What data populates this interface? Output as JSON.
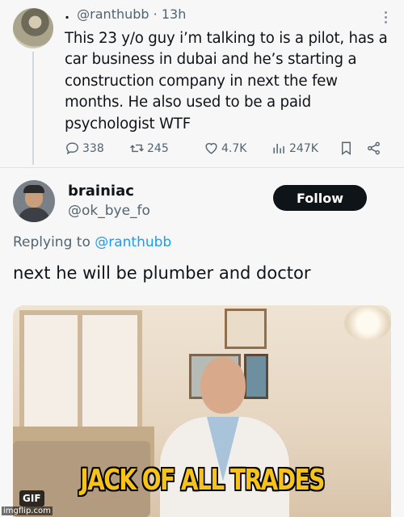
{
  "tweet": {
    "author_name": ".",
    "handle": "@ranthubb",
    "time": "13h",
    "text_lines": [
      "This 23 y/o guy i’m talking to is a pilot, has a",
      "car business in dubai and he’s starting a",
      "construction company in next the few",
      "months. He also used to be a paid",
      "psychologist WTF"
    ],
    "stats": {
      "replies": "338",
      "retweets": "245",
      "likes": "4.7K",
      "views": "247K"
    },
    "icons": [
      "more-icon",
      "reply-icon",
      "retweet-icon",
      "like-icon",
      "views-icon",
      "bookmark-icon",
      "share-icon"
    ]
  },
  "reply": {
    "name": "brainiac",
    "handle": "@ok_bye_fo",
    "follow_label": "Follow",
    "replying_prefix": "Replying to",
    "replying_handle": "@ranthubb",
    "text": "next he will be plumber and doctor"
  },
  "gif": {
    "caption": "JACK OF ALL TRADES",
    "badge": "GIF"
  },
  "watermark": "imgflip.com",
  "colors": {
    "text": "#0f1419",
    "secondary": "#536471",
    "link": "#1d9bf0",
    "follow_bg": "#0f1419",
    "caption": "#f7c31a"
  }
}
